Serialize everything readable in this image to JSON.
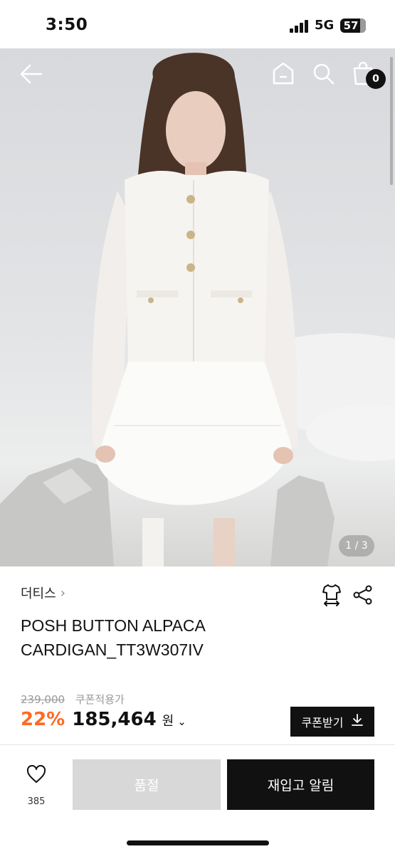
{
  "status_bar": {
    "time": "3:50",
    "network": "5G",
    "battery": "57"
  },
  "top_nav": {
    "icons": [
      "back-arrow-icon",
      "home-icon",
      "search-icon",
      "bag-icon"
    ],
    "cart_count": "0"
  },
  "gallery": {
    "counter": "1 / 3"
  },
  "product": {
    "brand": "더티스",
    "brand_chevron": "›",
    "name": "POSH BUTTON ALPACA CARDIGAN_TT3W307IV",
    "original_price": "239,000",
    "coupon_price_label": "쿠폰적용가",
    "discount": "22%",
    "sale_price": "185,464",
    "currency": "원",
    "price_chevron": "⌄",
    "icons": [
      "size-guide-icon",
      "share-icon"
    ]
  },
  "coupon_button": {
    "label": "쿠폰받기"
  },
  "bottom_bar": {
    "like_count": "385",
    "soldout_label": "품절",
    "restock_label": "재입고 알림"
  },
  "colors": {
    "accent_discount": "#ff6a22",
    "primary_button": "#111111",
    "disabled_button": "#d8d8d8"
  }
}
